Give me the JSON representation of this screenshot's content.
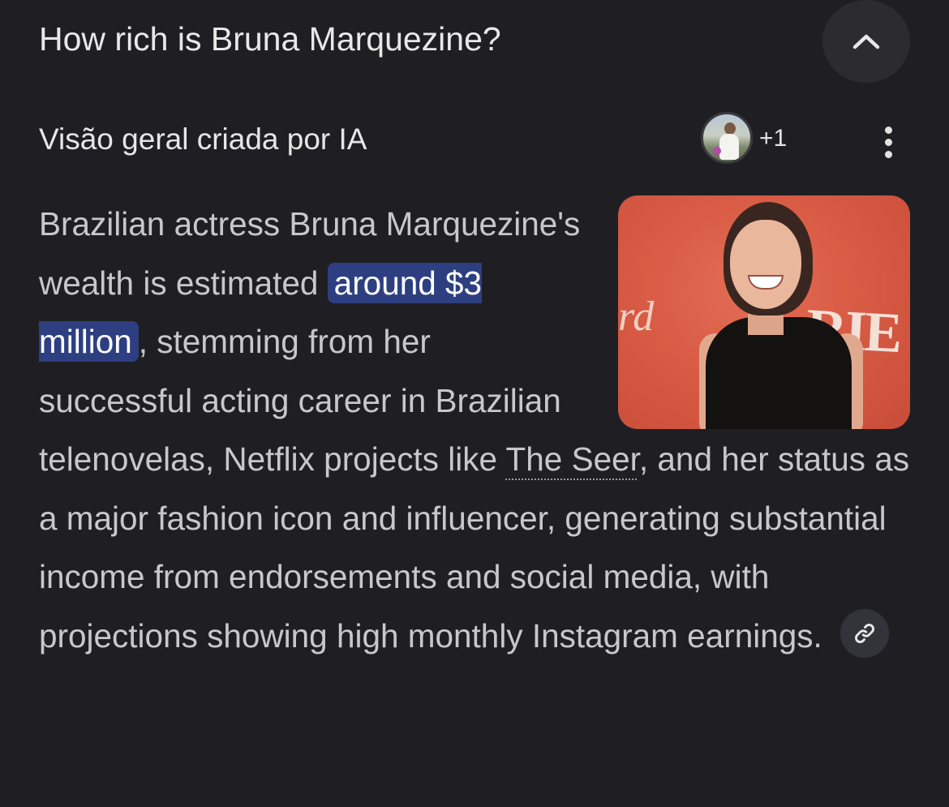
{
  "question": {
    "title": "How rich is Bruna Marquezine?",
    "collapse_icon": "chevron-up-icon"
  },
  "overview": {
    "label": "Visão geral criada por IA",
    "contributors_extra": "+1",
    "more_icon": "more-vert-icon"
  },
  "answer": {
    "text_before_highlight": "Brazilian actress Bruna Marquezine's wealth is estimated ",
    "highlight": "around $3 million",
    "text_after_highlight": ", stemming from her successful acting career in Brazilian telenovelas, Netflix projects like ",
    "link_text": "The Seer",
    "text_end": ", and her status as a major fashion icon and influencer, generating substantial income from endorsements and social media, with projections showing high monthly Instagram earnings.",
    "link_icon": "link-icon"
  },
  "image": {
    "backdrop_text_left": "rd",
    "backdrop_text_right": "RIE"
  },
  "colors": {
    "background": "#1f1f23",
    "highlight_bg": "#2d3f80",
    "photo_bg": "#d95c45"
  }
}
